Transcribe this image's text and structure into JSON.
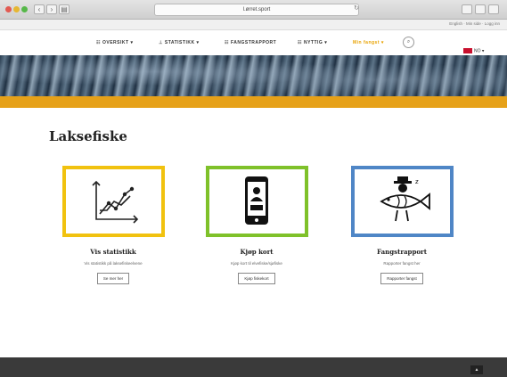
{
  "browser": {
    "url": "l.ørret.sport",
    "reload_glyph": "↻"
  },
  "topbar": {
    "links": "English · Min side · Logg inn"
  },
  "nav": {
    "items": [
      {
        "icon": "☷",
        "label": "OVERSIKT",
        "caret": "▾"
      },
      {
        "icon": "⊥",
        "label": "STATISTIKK",
        "caret": "▾"
      },
      {
        "icon": "☷",
        "label": "FANGSTRAPPORT",
        "caret": ""
      },
      {
        "icon": "☷",
        "label": "NYTTIG",
        "caret": "▾"
      }
    ],
    "cta": {
      "label": "Min fangst",
      "caret": "▾"
    },
    "search_glyph": "⌕"
  },
  "language": {
    "code": "NO",
    "caret": "▾"
  },
  "page": {
    "title": "Laksefiske"
  },
  "cards": [
    {
      "color": "#f1c20f",
      "icon": "line-chart-icon",
      "title": "Vis statistikk",
      "desc": "Vis statistikk på laksefiskeelvene",
      "button": "Se mer her"
    },
    {
      "color": "#7fc12a",
      "icon": "mobile-phone-icon",
      "title": "Kjøp kort",
      "desc": "Kjøp kort til elvefiske/sjøfiske",
      "button": "Kjøp fiskekort"
    },
    {
      "color": "#4f86c6",
      "icon": "fish-report-icon",
      "title": "Fangstrapport",
      "desc": "Rapporter fangst her",
      "button": "Rapporter fangst"
    }
  ],
  "footer": {
    "totop_glyph": "▲"
  }
}
